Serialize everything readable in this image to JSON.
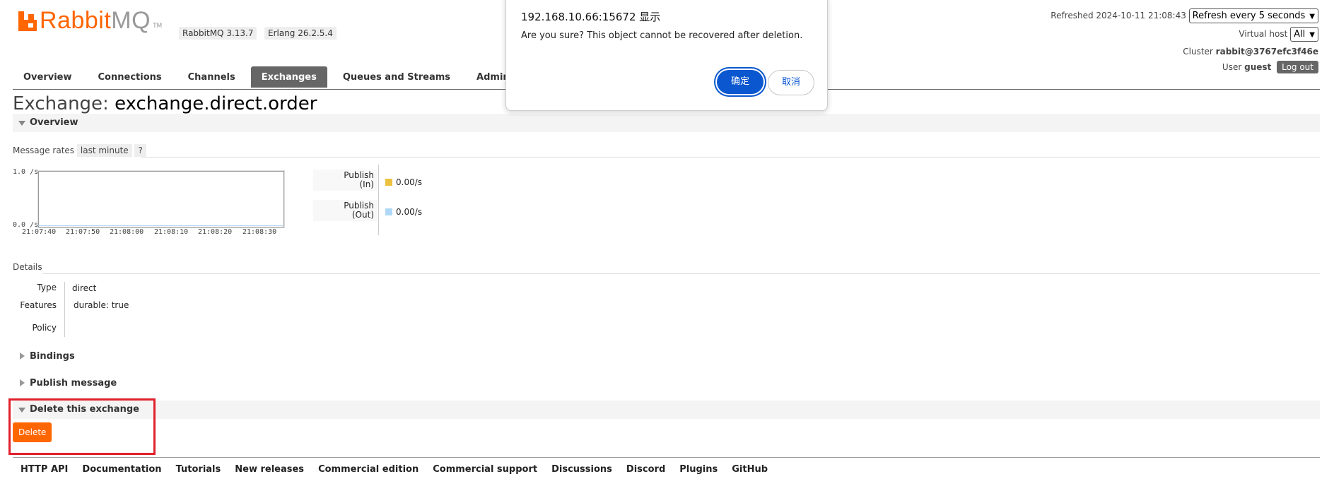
{
  "header": {
    "logo_brand": "Rabbit",
    "logo_suffix": "MQ",
    "logo_tm": "TM",
    "rabbitmq_version": "RabbitMQ 3.13.7",
    "erlang_version": "Erlang 26.2.5.4",
    "refreshed_label": "Refreshed 2024-10-11 21:08:43",
    "refresh_select": "Refresh every 5 seconds",
    "virtual_host_label": "Virtual host",
    "virtual_host_value": "All",
    "cluster_label": "Cluster",
    "cluster_value": "rabbit@3767efc3f46e",
    "user_label": "User",
    "user_value": "guest",
    "logout_label": "Log out"
  },
  "tabs": [
    {
      "label": "Overview",
      "active": false
    },
    {
      "label": "Connections",
      "active": false
    },
    {
      "label": "Channels",
      "active": false
    },
    {
      "label": "Exchanges",
      "active": true
    },
    {
      "label": "Queues and Streams",
      "active": false
    },
    {
      "label": "Admin",
      "active": false
    }
  ],
  "page": {
    "title_prefix": "Exchange:",
    "title_name": "exchange.direct.order"
  },
  "overview": {
    "section_label": "Overview",
    "message_rates_label": "Message rates",
    "range_badge": "last minute",
    "help_badge": "?",
    "chart": {
      "y_max_label": "1.0 /s",
      "y_min_label": "0.0 /s",
      "x_labels": [
        "21:07:40",
        "21:07:50",
        "21:08:00",
        "21:08:10",
        "21:08:20",
        "21:08:30"
      ]
    },
    "rates": [
      {
        "label_line1": "Publish",
        "label_line2": "(In)",
        "value": "0.00/s",
        "color": "#edc240"
      },
      {
        "label_line1": "Publish",
        "label_line2": "(Out)",
        "value": "0.00/s",
        "color": "#afd8f8"
      }
    ]
  },
  "details": {
    "heading": "Details",
    "type_key": "Type",
    "type_value": "direct",
    "features_key": "Features",
    "features_name": "durable:",
    "features_value": "true",
    "policy_key": "Policy"
  },
  "sections": {
    "bindings": "Bindings",
    "publish_message": "Publish message",
    "delete_exchange": "Delete this exchange",
    "delete_button": "Delete"
  },
  "footer": [
    "HTTP API",
    "Documentation",
    "Tutorials",
    "New releases",
    "Commercial edition",
    "Commercial support",
    "Discussions",
    "Discord",
    "Plugins",
    "GitHub"
  ],
  "dialog": {
    "origin": "192.168.10.66:15672 显示",
    "message": "Are you sure? This object cannot be recovered after deletion.",
    "ok_label": "确定",
    "cancel_label": "取消"
  },
  "colors": {
    "brand": "#ff6600",
    "highlight_box": "#e0202a",
    "dialog_primary": "#0b57d0"
  }
}
